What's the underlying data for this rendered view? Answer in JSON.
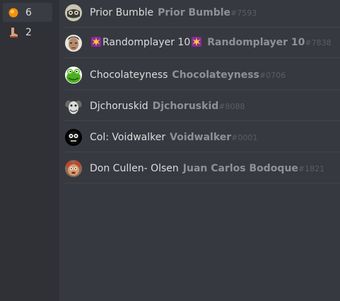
{
  "reactions": [
    {
      "emoji": "orange-circle-icon",
      "count": "6",
      "active": true
    },
    {
      "emoji": "boot-icon",
      "count": "2",
      "active": false
    }
  ],
  "users": [
    {
      "nickname": "Prior Bumble",
      "username": "Prior Bumble",
      "discriminator": "#7593",
      "avatar": "goggles-avatar"
    },
    {
      "nickname_prefix": "💥",
      "nickname": "Randomplayer 10",
      "nickname_suffix": "💥",
      "username": "Randomplayer 10",
      "discriminator": "#7838",
      "avatar": "face-avatar"
    },
    {
      "nickname": "Chocolateyness",
      "username": "Chocolateyness",
      "discriminator": "#0706",
      "avatar": "frog-avatar"
    },
    {
      "nickname": "Djchoruskid",
      "username": "Djchoruskid",
      "discriminator": "#8088",
      "avatar": "clown-avatar"
    },
    {
      "nickname": "Col: Voidwalker",
      "username": "Voidwalker",
      "discriminator": "#0001",
      "avatar": "dark-face-avatar"
    },
    {
      "nickname": "Don Cullen- Olsen",
      "username": "Juan Carlos Bodoque",
      "discriminator": "#1821",
      "avatar": "puppet-avatar"
    }
  ],
  "colors": {
    "background": "#36393f",
    "sidebar": "#2f3136",
    "selected": "#393c43",
    "nickname": "#dcddde",
    "username": "#8e9297",
    "discriminator": "#5b5e63"
  }
}
